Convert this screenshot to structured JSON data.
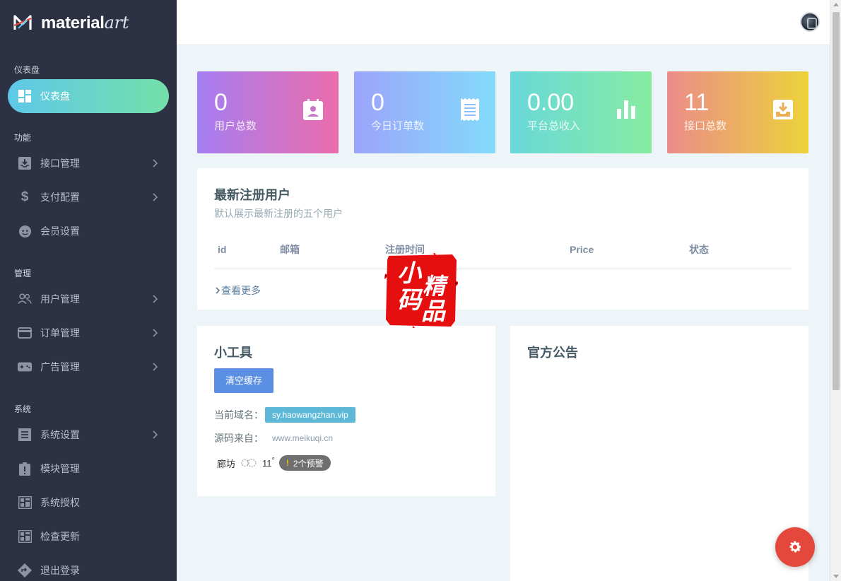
{
  "brand": {
    "name": "material",
    "name_script": "art"
  },
  "sidebar": {
    "sections": [
      {
        "label": "仪表盘"
      },
      {
        "label": "功能"
      },
      {
        "label": "管理"
      },
      {
        "label": "系统"
      }
    ],
    "items": [
      {
        "label": "仪表盘",
        "icon": "dashboard-icon",
        "active": true,
        "has_chevron": false
      },
      {
        "label": "接口管理",
        "icon": "inbox-icon",
        "has_chevron": true
      },
      {
        "label": "支付配置",
        "icon": "dollar-icon",
        "has_chevron": true
      },
      {
        "label": "会员设置",
        "icon": "face-icon",
        "has_chevron": false
      },
      {
        "label": "用户管理",
        "icon": "users-icon",
        "has_chevron": true
      },
      {
        "label": "订单管理",
        "icon": "credit-card-icon",
        "has_chevron": true
      },
      {
        "label": "广告管理",
        "icon": "gamepad-icon",
        "has_chevron": true
      },
      {
        "label": "系统设置",
        "icon": "list-icon",
        "has_chevron": true
      },
      {
        "label": "模块管理",
        "icon": "clipboard-alert-icon",
        "has_chevron": false
      },
      {
        "label": "系统授权",
        "icon": "grid-icon",
        "has_chevron": false
      },
      {
        "label": "检查更新",
        "icon": "grid-icon",
        "has_chevron": false
      },
      {
        "label": "退出登录",
        "icon": "diamond-arrow-icon",
        "has_chevron": false
      }
    ]
  },
  "stats": [
    {
      "value": "0",
      "label": "用户总数",
      "icon": "contact-card-icon"
    },
    {
      "value": "0",
      "label": "今日订单数",
      "icon": "receipt-icon"
    },
    {
      "value": "0.00",
      "label": "平台总收入",
      "icon": "bar-chart-icon"
    },
    {
      "value": "11",
      "label": "接口总数",
      "icon": "inbox-download-icon"
    }
  ],
  "recent_users": {
    "title": "最新注册用户",
    "subtitle": "默认展示最新注册的五个用户",
    "columns": [
      "id",
      "邮箱",
      "注册时间",
      "Price",
      "状态"
    ],
    "rows": [],
    "more_link": "查看更多"
  },
  "tools": {
    "title": "小工具",
    "clear_cache_button": "清空缓存",
    "domain_label": "当前域名：",
    "domain_value": "sy.haowangzhan.vip",
    "source_label": "源码来自：",
    "source_value": "www.meikuqi.cn",
    "weather": {
      "city": "廊坊",
      "temp": "11",
      "degree": "°",
      "warning": "2个预警"
    }
  },
  "announcement": {
    "title": "官方公告"
  },
  "watermark": {
    "chars": [
      "小",
      "码",
      "精",
      "品"
    ]
  },
  "colors": {
    "sidebar_bg": "#2c3144",
    "accent_gradient": [
      "#5fc8e9",
      "#73e0a9"
    ],
    "fab": "#e4473b",
    "button_primary": "#5b8fe4"
  }
}
